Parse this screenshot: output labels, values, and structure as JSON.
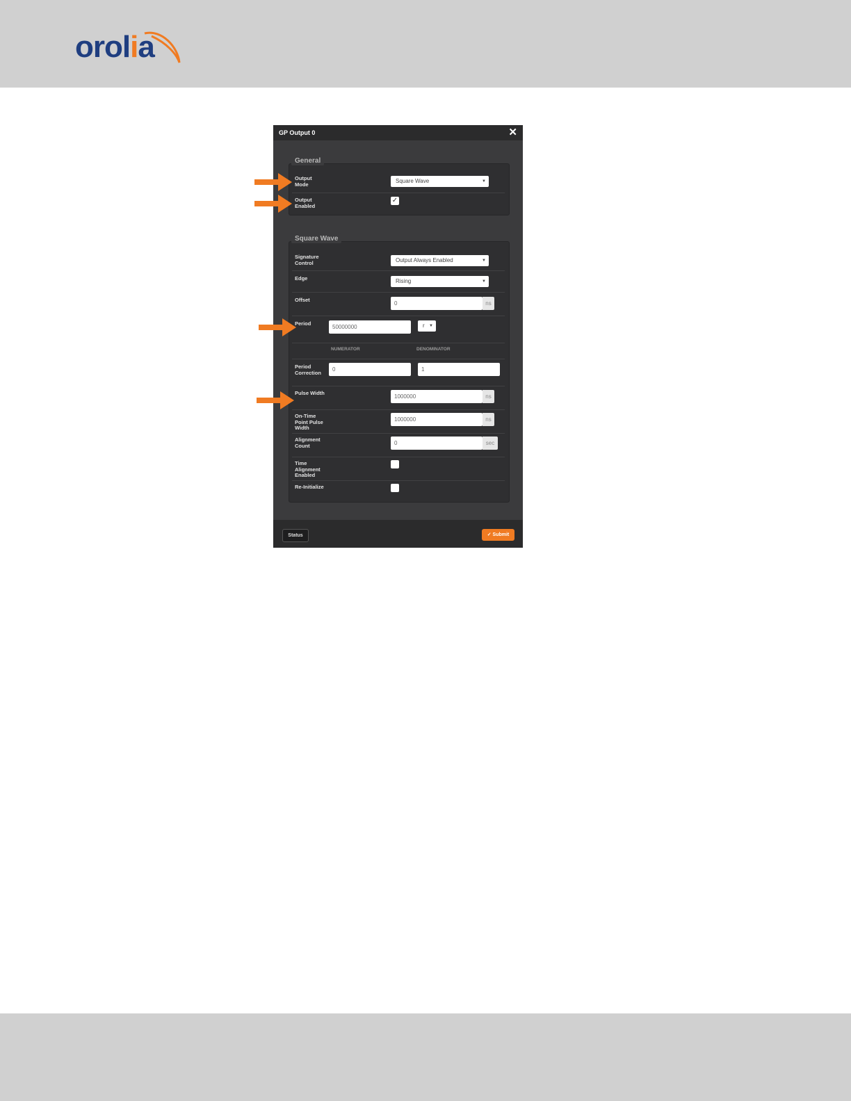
{
  "logo": {
    "text_main": "orol",
    "text_accent": "i",
    "text_end": "a"
  },
  "dialog": {
    "title": "GP Output 0",
    "close_glyph": "✕",
    "general": {
      "legend": "General",
      "output_mode": {
        "label_line1": "Output",
        "label_line2": "Mode",
        "value": "Square Wave"
      },
      "output_enabled": {
        "label_line1": "Output",
        "label_line2": "Enabled",
        "checked": "✓"
      }
    },
    "square_wave": {
      "legend": "Square Wave",
      "signature_control": {
        "label_line1": "Signature",
        "label_line2": "Control",
        "value": "Output Always Enabled"
      },
      "edge": {
        "label": "Edge",
        "value": "Rising"
      },
      "offset": {
        "label": "Offset",
        "value": "0",
        "unit": "ns"
      },
      "period": {
        "label": "Period",
        "value": "50000000",
        "unit_select": "r"
      },
      "numerator_header": "NUMERATOR",
      "denominator_header": "DENOMINATOR",
      "period_correction": {
        "label_line1": "Period",
        "label_line2": "Correction",
        "numerator": "0",
        "denominator": "1"
      },
      "pulse_width": {
        "label": "Pulse Width",
        "value": "1000000",
        "unit": "ns"
      },
      "on_time_pulse_width": {
        "label_line1": "On-Time",
        "label_line2": "Point Pulse",
        "label_line3": "Width",
        "value": "1000000",
        "unit": "ns"
      },
      "alignment_count": {
        "label_line1": "Alignment",
        "label_line2": "Count",
        "value": "0",
        "unit": "sec"
      },
      "time_alignment_enabled": {
        "label_line1": "Time",
        "label_line2": "Alignment",
        "label_line3": "Enabled"
      },
      "re_initialize": {
        "label": "Re-Initialize"
      }
    },
    "footer": {
      "status_label": "Status",
      "submit_label": "✓ Submit"
    }
  },
  "colors": {
    "accent": "#f07b22",
    "brand": "#1f3e80",
    "dialog_bg": "#3b3b3d"
  }
}
